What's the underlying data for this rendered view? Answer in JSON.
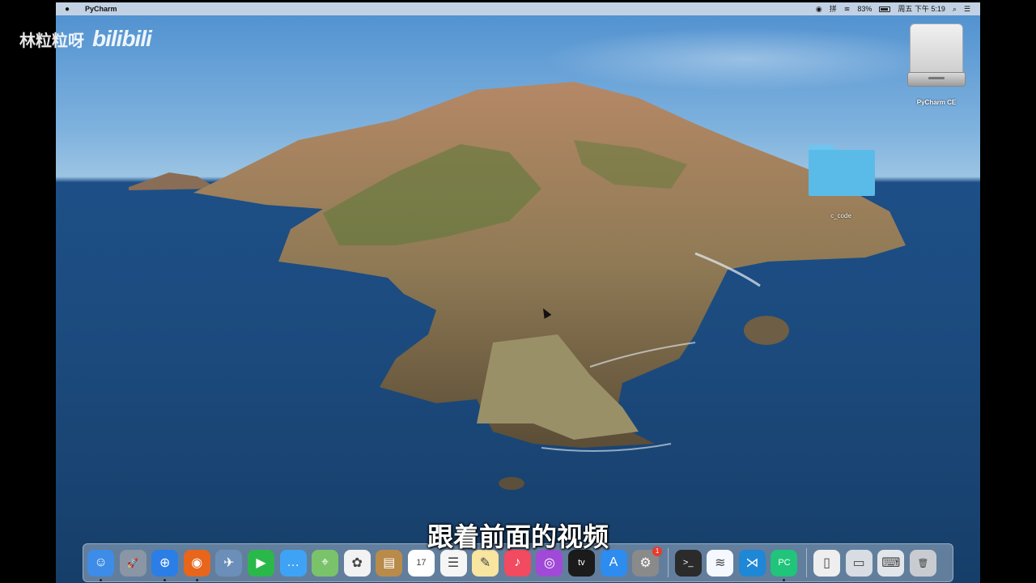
{
  "menubar": {
    "app_name": "PyCharm",
    "battery_label": "83%",
    "battery_level": 0.83,
    "clock": "周五 下午 5:19"
  },
  "desktop": {
    "drive_label": "PyCharm CE",
    "folder_label": "c_code"
  },
  "dock": {
    "items": [
      {
        "name": "finder",
        "color": "#3d8ce8",
        "glyph": "☺",
        "running": true
      },
      {
        "name": "launchpad",
        "color": "#8a95a5",
        "glyph": "🚀",
        "running": false
      },
      {
        "name": "safari",
        "color": "#2a7ee6",
        "glyph": "⊕",
        "running": true
      },
      {
        "name": "firefox",
        "color": "#e8651c",
        "glyph": "◉",
        "running": true
      },
      {
        "name": "preview",
        "color": "#6b8fb8",
        "glyph": "✈",
        "running": false
      },
      {
        "name": "facetime",
        "color": "#2bb84a",
        "glyph": "▶",
        "running": false
      },
      {
        "name": "messages",
        "color": "#3fa3f5",
        "glyph": "…",
        "running": false
      },
      {
        "name": "maps",
        "color": "#7ac36a",
        "glyph": "⌖",
        "running": false
      },
      {
        "name": "photos",
        "color": "#f2f2f2",
        "glyph": "✿",
        "running": false
      },
      {
        "name": "notes-app",
        "color": "#b88b4a",
        "glyph": "▤",
        "running": false
      },
      {
        "name": "calendar",
        "color": "#ffffff",
        "glyph": "17",
        "running": false
      },
      {
        "name": "reminders",
        "color": "#f5f5f5",
        "glyph": "☰",
        "running": false
      },
      {
        "name": "stickies",
        "color": "#f7e5a0",
        "glyph": "✎",
        "running": false
      },
      {
        "name": "music",
        "color": "#f24a60",
        "glyph": "♪",
        "running": false
      },
      {
        "name": "podcasts",
        "color": "#a14ad7",
        "glyph": "◎",
        "running": false
      },
      {
        "name": "tv",
        "color": "#1b1b1b",
        "glyph": "tv",
        "running": false
      },
      {
        "name": "app-store",
        "color": "#2d8cf0",
        "glyph": "A",
        "running": false
      },
      {
        "name": "system-preferences",
        "color": "#8a8a8a",
        "glyph": "⚙",
        "running": false,
        "badge": "1"
      },
      {
        "name": "terminal",
        "color": "#2b2b2b",
        "glyph": ">_",
        "running": false
      },
      {
        "name": "lark",
        "color": "#f5f8ff",
        "glyph": "≋",
        "running": false
      },
      {
        "name": "vscode",
        "color": "#1e87d6",
        "glyph": "⋊",
        "running": false
      },
      {
        "name": "pycharm",
        "color": "#20c47a",
        "glyph": "PC",
        "running": true
      },
      {
        "name": "document",
        "color": "#eeeeee",
        "glyph": "▯",
        "running": false
      },
      {
        "name": "screenshot-window",
        "color": "#d8dde4",
        "glyph": "▭",
        "running": false
      },
      {
        "name": "keyboard-viewer",
        "color": "#e2e6ea",
        "glyph": "⌨",
        "running": false
      },
      {
        "name": "trash",
        "color": "#c8ccd1",
        "glyph": "🗑",
        "running": false
      }
    ]
  },
  "overlay": {
    "watermark_text": "林粒粒呀",
    "logo_text": "bilibili",
    "subtitle": "跟着前面的视频"
  }
}
